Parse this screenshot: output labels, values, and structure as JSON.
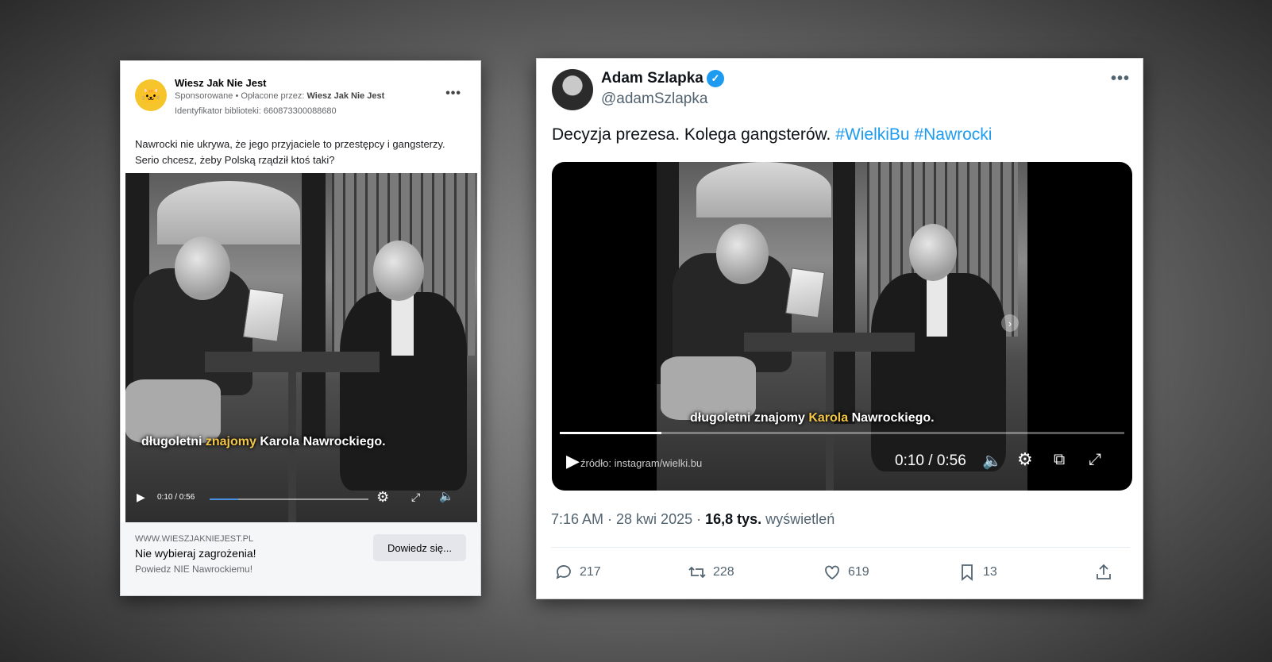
{
  "facebook_ad": {
    "page_name": "Wiesz Jak Nie Jest",
    "sponsored": "Sponsorowane",
    "paid_by_label": " • Opłacone przez: ",
    "paid_by": "Wiesz Jak Nie Jest",
    "library_id": "Identyfikator biblioteki: 660873300088680",
    "more": "•••",
    "post_text": "Nawrocki nie ukrywa, że jego przyjaciele to przestępcy i gangsterzy. Serio chcesz, żeby Polską rządził ktoś taki?",
    "video": {
      "caption_pre": "długoletni ",
      "caption_hl": "znajomy",
      "caption_post": " Karola Nawrockiego.",
      "time": "0:10 / 0:56",
      "progress": 0.18
    },
    "domain": "WWW.WIESZJAKNIEJEST.PL",
    "cta_title": "Nie wybieraj zagrożenia!",
    "cta_sub": "Powiedz NIE Nawrockiemu!",
    "cta_button": "Dowiedz się..."
  },
  "tweet": {
    "author": "Adam Szlapka",
    "handle": "@adamSzlapka",
    "more": "•••",
    "text": "Decyzja prezesa. Kolega gangsterów. ",
    "hashtag1": "#WielkiBu",
    "hashtag2": "#Nawrocki",
    "video": {
      "caption_pre": "długoletni znajomy ",
      "caption_hl": "Karola",
      "caption_post": " Nawrockiego.",
      "source": "źródło: instagram/wielki.bu",
      "time": "0:10 / 0:56",
      "progress": 0.18
    },
    "time_date": "7:16 AM · 28 kwi 2025 · ",
    "views_count": "16,8 tys.",
    "views_label": " wyświetleń",
    "replies": "217",
    "retweets": "228",
    "likes": "619",
    "bookmarks": "13"
  }
}
